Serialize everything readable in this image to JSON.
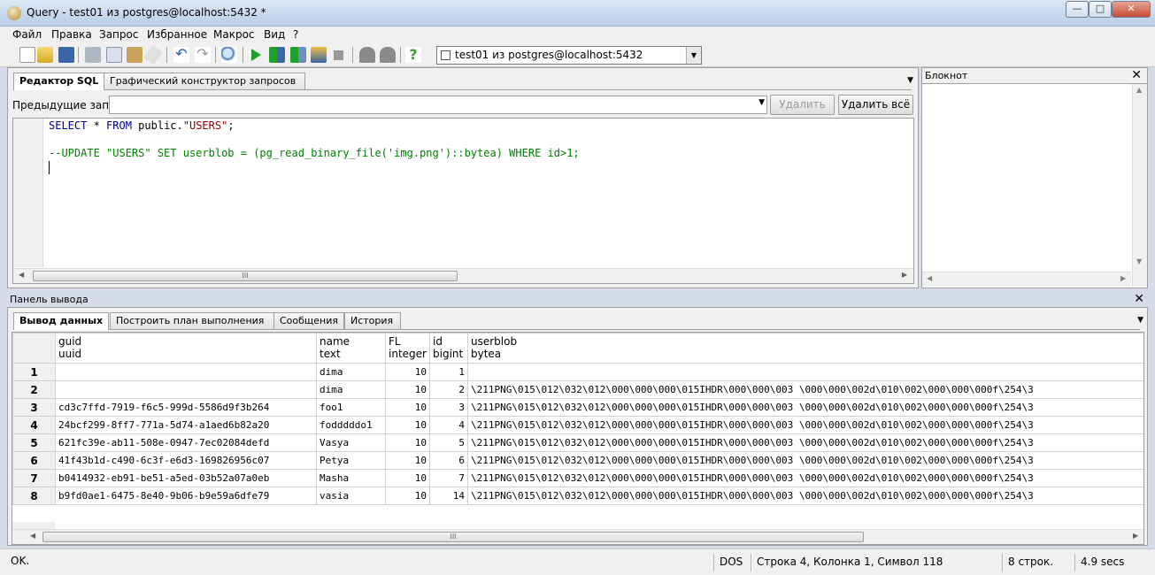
{
  "window": {
    "title": "Query - test01 из postgres@localhost:5432 *",
    "controls": {
      "minimize": "—",
      "maximize": "□",
      "close": "✕"
    }
  },
  "menu": [
    "Файл",
    "Правка",
    "Запрос",
    "Избранное",
    "Макрос",
    "Вид",
    "?"
  ],
  "toolbar": {
    "icons": [
      "new-file-icon",
      "open-folder-icon",
      "save-icon",
      "cut-icon",
      "copy-icon",
      "paste-icon",
      "clear-icon",
      "undo-icon",
      "redo-icon",
      "find-icon",
      "execute-icon",
      "explain-icon",
      "execute-to-file-icon",
      "explain-analyze-icon",
      "stop-icon",
      "commit-icon",
      "rollback-icon",
      "help-icon"
    ],
    "connection": "test01 из postgres@localhost:5432"
  },
  "editor": {
    "tabs": [
      "Редактор SQL",
      "Графический конструктор запросов"
    ],
    "prev_label": "Предыдущие запросы",
    "delete_label": "Удалить",
    "delete_all_label": "Удалить всё",
    "line1": {
      "kw1": "SELECT",
      "mid": " * ",
      "kw2": "FROM",
      "rest": " public.",
      "str": "\"USERS\"",
      "end": ";"
    },
    "line3": "--UPDATE \"USERS\" SET userblob = (pg_read_binary_file('img.png')::bytea) WHERE id>1;",
    "scroll_thumb": "III"
  },
  "notepad": {
    "title": "Блокнот",
    "close": "✕"
  },
  "output": {
    "header": "Панель вывода",
    "close": "✕",
    "tabs": [
      "Вывод данных",
      "Построить план выполнения",
      "Сообщения",
      "История"
    ],
    "columns": [
      {
        "name": "guid",
        "type": "uuid"
      },
      {
        "name": "name",
        "type": "text"
      },
      {
        "name": "FL",
        "type": "integer"
      },
      {
        "name": "id",
        "type": "bigint"
      },
      {
        "name": "userblob",
        "type": "bytea"
      }
    ],
    "rows": [
      [
        "1",
        "",
        "dima",
        "10",
        "1",
        ""
      ],
      [
        "2",
        "",
        "dima",
        "10",
        "2",
        "\\211PNG\\015\\012\\032\\012\\000\\000\\000\\015IHDR\\000\\000\\003 \\000\\000\\002d\\010\\002\\000\\000\\000f\\254\\3"
      ],
      [
        "3",
        "cd3c7ffd-7919-f6c5-999d-5586d9f3b264",
        "foo1",
        "10",
        "3",
        "\\211PNG\\015\\012\\032\\012\\000\\000\\000\\015IHDR\\000\\000\\003 \\000\\000\\002d\\010\\002\\000\\000\\000f\\254\\3"
      ],
      [
        "4",
        "24bcf299-8ff7-771a-5d74-a1aed6b82a20",
        "fodddddo1",
        "10",
        "4",
        "\\211PNG\\015\\012\\032\\012\\000\\000\\000\\015IHDR\\000\\000\\003 \\000\\000\\002d\\010\\002\\000\\000\\000f\\254\\3"
      ],
      [
        "5",
        "621fc39e-ab11-508e-0947-7ec02084defd",
        "Vasya",
        "10",
        "5",
        "\\211PNG\\015\\012\\032\\012\\000\\000\\000\\015IHDR\\000\\000\\003 \\000\\000\\002d\\010\\002\\000\\000\\000f\\254\\3"
      ],
      [
        "6",
        "41f43b1d-c490-6c3f-e6d3-169826956c07",
        "Petya",
        "10",
        "6",
        "\\211PNG\\015\\012\\032\\012\\000\\000\\000\\015IHDR\\000\\000\\003 \\000\\000\\002d\\010\\002\\000\\000\\000f\\254\\3"
      ],
      [
        "7",
        "b0414932-eb91-be51-a5ed-03b52a07a0eb",
        "Masha",
        "10",
        "7",
        "\\211PNG\\015\\012\\032\\012\\000\\000\\000\\015IHDR\\000\\000\\003 \\000\\000\\002d\\010\\002\\000\\000\\000f\\254\\3"
      ],
      [
        "8",
        "b9fd0ae1-6475-8e40-9b06-b9e59a6dfe79",
        "vasia",
        "10",
        "14",
        "\\211PNG\\015\\012\\032\\012\\000\\000\\000\\015IHDR\\000\\000\\003 \\000\\000\\002d\\010\\002\\000\\000\\000f\\254\\3"
      ]
    ],
    "scroll_thumb": "III"
  },
  "status": {
    "state": "OK.",
    "encoding": "DOS",
    "position": "Строка 4, Колонка 1, Символ 118",
    "rows": "8 строк.",
    "time": "4.9 secs"
  },
  "colors": {
    "keyword": "#00008b",
    "string": "#8b0000",
    "comment": "#008000"
  }
}
